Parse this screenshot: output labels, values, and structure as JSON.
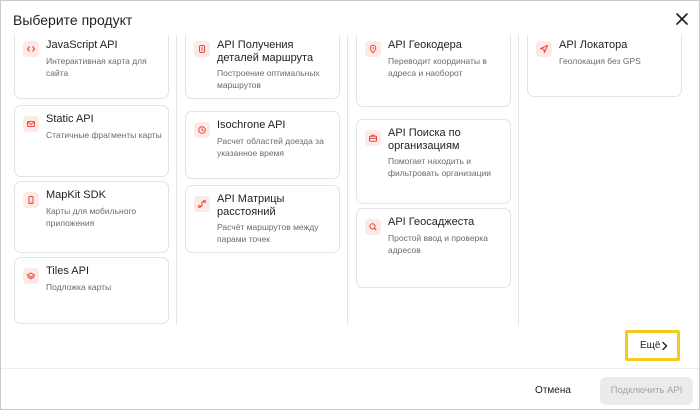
{
  "dialog": {
    "title": "Выберите продукт",
    "more_label": "Ещё",
    "cancel_label": "Отмена",
    "connect_label": "Подключить API"
  },
  "accent_color": "#e5483b",
  "highlight_color": "#f4cb1b",
  "columns": [
    [
      {
        "name": "JavaScript API",
        "desc": "Интерактивная карта для сайта",
        "icon": "code-icon"
      },
      {
        "name": "Static API",
        "desc": "Статичные фрагменты карты",
        "icon": "envelope-icon"
      },
      {
        "name": "MapKit SDK",
        "desc": "Карты для мобильного приложения",
        "icon": "phone-icon"
      },
      {
        "name": "Tiles API",
        "desc": "Подложка карты",
        "icon": "layers-icon"
      }
    ],
    [
      {
        "name": "API Получения деталей маршрута",
        "desc": "Построение оптимальных маршрутов",
        "icon": "route-icon"
      },
      {
        "name": "Isochrone API",
        "desc": "Расчет областей доезда за указанное время",
        "icon": "clock-icon"
      },
      {
        "name": "API Матрицы расстояний",
        "desc": "Расчёт маршрутов между парами точек",
        "icon": "path-icon"
      }
    ],
    [
      {
        "name": "API Геокодера",
        "desc": "Переводит координаты в адреса и наоборот",
        "icon": "pin-icon"
      },
      {
        "name": "API Поиска по организациям",
        "desc": "Помогает находить и фильтровать организации",
        "icon": "briefcase-icon"
      },
      {
        "name": "API Геосаджеста",
        "desc": "Простой ввод и проверка адресов",
        "icon": "search-icon"
      }
    ],
    [
      {
        "name": "API Локатора",
        "desc": "Геолокация без GPS",
        "icon": "navigation-icon"
      }
    ]
  ]
}
